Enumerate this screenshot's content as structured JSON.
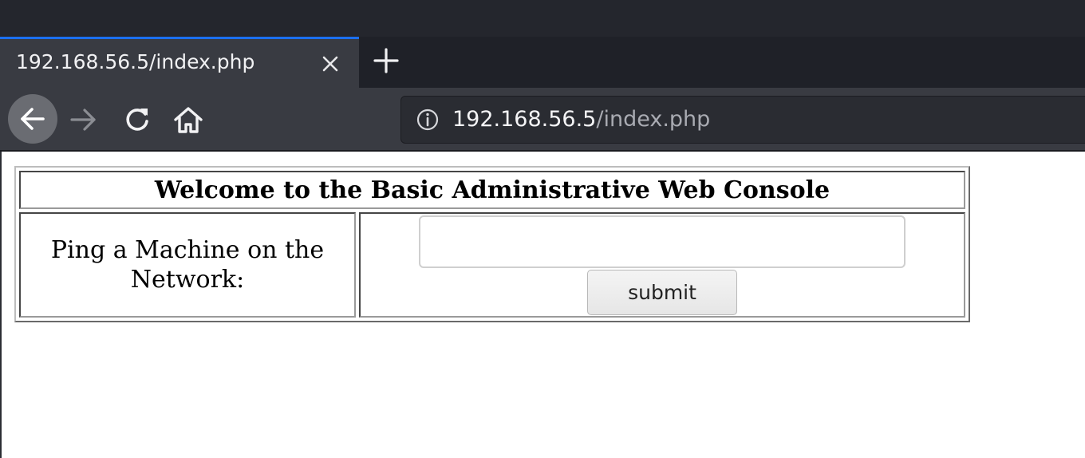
{
  "browser": {
    "tab": {
      "title": "192.168.56.5/index.php"
    },
    "url": {
      "host": "192.168.56.5",
      "path": "/index.php"
    },
    "accent_color": "#1c6ff0"
  },
  "page": {
    "heading": "Welcome to the Basic Administrative Web Console",
    "ping_label": "Ping a Machine on the Network:",
    "ping_input_value": "",
    "submit_label": "submit"
  }
}
